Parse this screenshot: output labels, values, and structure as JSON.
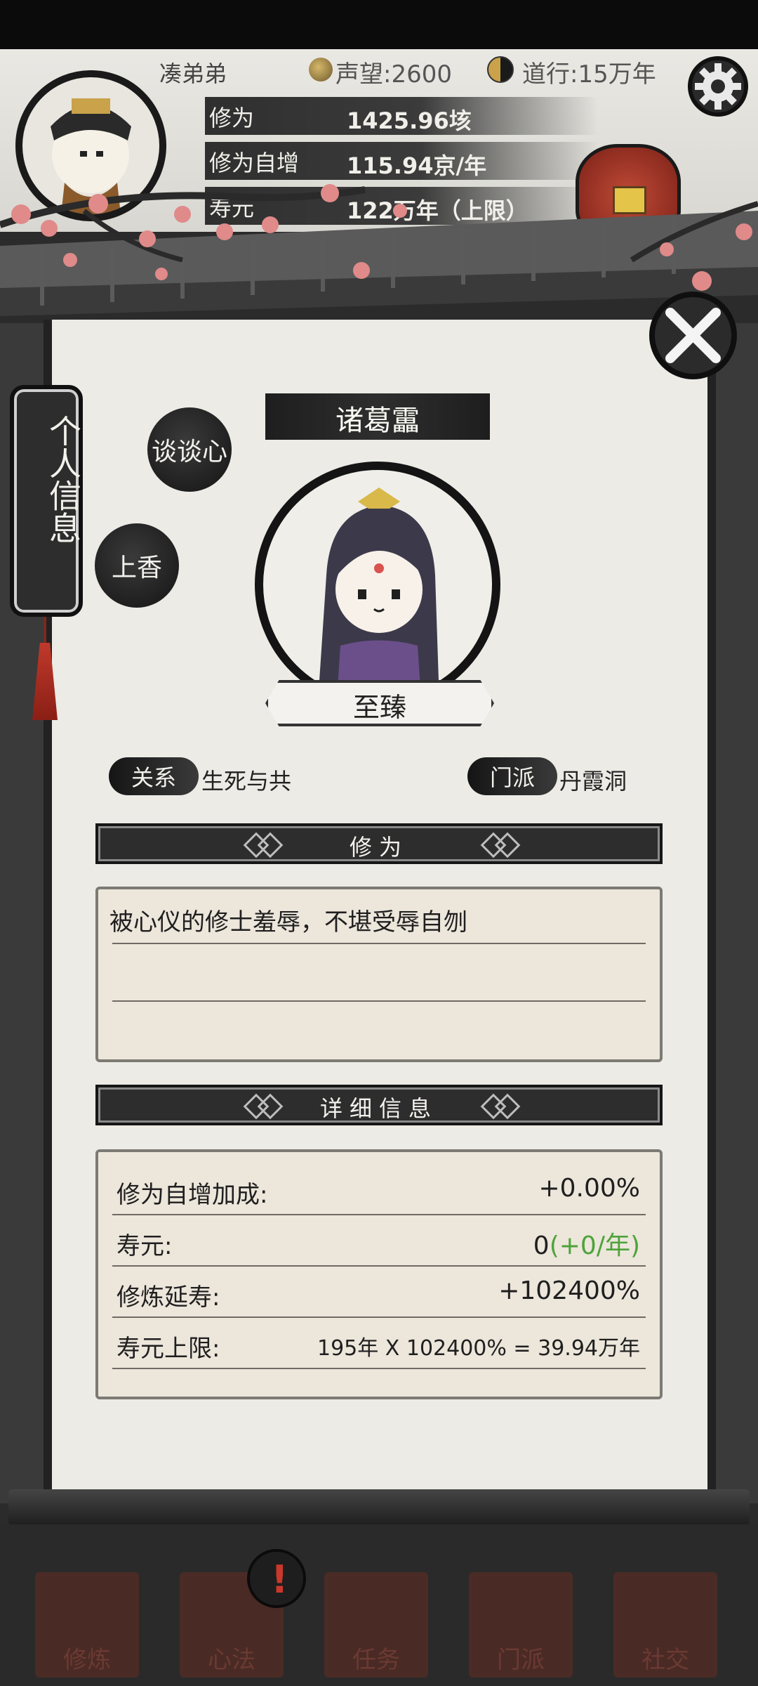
{
  "header": {
    "player_name": "凑弟弟",
    "reputation_label": "声望:2600",
    "dao_label": "道行:15万年"
  },
  "stats": [
    {
      "label": "修为",
      "value": "1425.96垓"
    },
    {
      "label": "修为自增",
      "value": "115.94京/年"
    },
    {
      "label": "寿元",
      "value": "122万年（上限）"
    }
  ],
  "side_tab": {
    "label": "个人信息"
  },
  "actions": {
    "talk": "谈谈心",
    "incense": "上香"
  },
  "npc": {
    "name": "诸葛靁",
    "rank": "至臻",
    "relation_label": "关系",
    "relation_value": "生死与共",
    "sect_label": "门派",
    "sect_value": "丹霞洞"
  },
  "cultivation_section": {
    "title": "修为",
    "text": "被心仪的修士羞辱，不堪受辱自刎"
  },
  "details_section": {
    "title": "详细信息",
    "rows": [
      {
        "label": "修为自增加成:",
        "value": "+0.00%",
        "extra": ""
      },
      {
        "label": "寿元:",
        "value": "0",
        "extra": "(+0/年)"
      },
      {
        "label": "修炼延寿:",
        "value": "+102400%",
        "extra": ""
      },
      {
        "label": "寿元上限:",
        "value": "195年 X 102400% = 39.94万年",
        "extra": ""
      }
    ]
  },
  "bottom_nav": [
    {
      "label": "修炼",
      "icon": "mountain-icon"
    },
    {
      "label": "心法",
      "icon": "scroll-icon"
    },
    {
      "label": "任务",
      "icon": "task-icon"
    },
    {
      "label": "门派",
      "icon": "temple-icon"
    },
    {
      "label": "社交",
      "icon": "people-icon"
    }
  ],
  "colors": {
    "accent_green": "#4da33a",
    "ink": "#1f1f1f",
    "paper": "#ecebe6",
    "alert_red": "#c9382a"
  }
}
